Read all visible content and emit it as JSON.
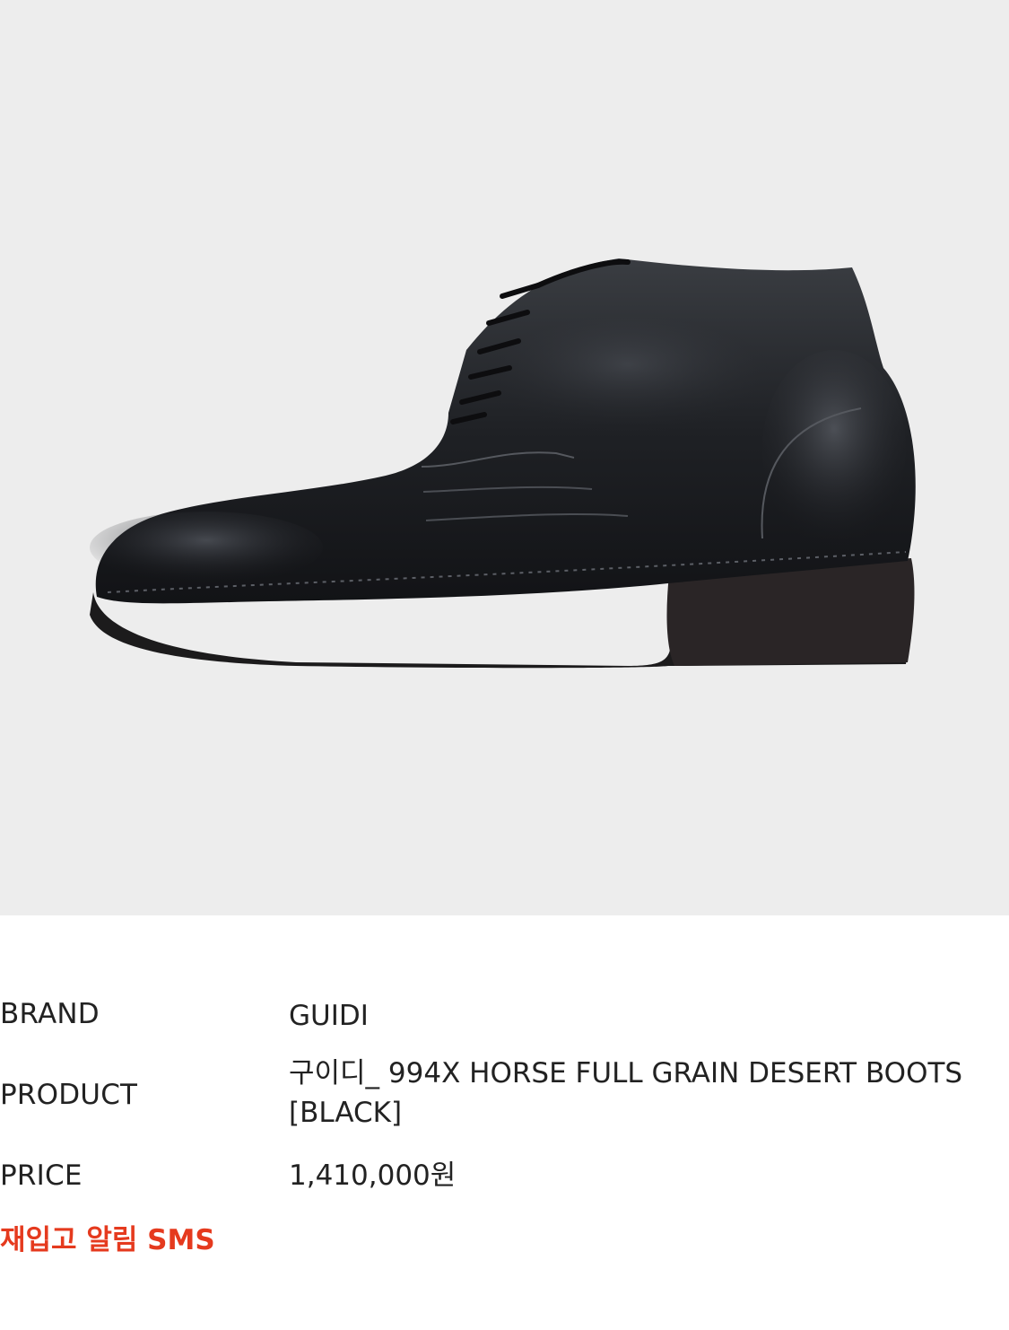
{
  "product_image": {
    "alt": "GUIDI 994X black leather desert boot, side view",
    "background_color": "#ededed"
  },
  "details": {
    "brand_label": "BRAND",
    "brand_value": "GUIDI",
    "product_label": "PRODUCT",
    "product_value": "구이디_ 994X HORSE FULL GRAIN DESERT BOOTS [BLACK]",
    "price_label": "PRICE",
    "price_value": "1,410,000원"
  },
  "restock_alert": {
    "label": "재입고 알림 SMS",
    "color": "#e53a1e"
  }
}
